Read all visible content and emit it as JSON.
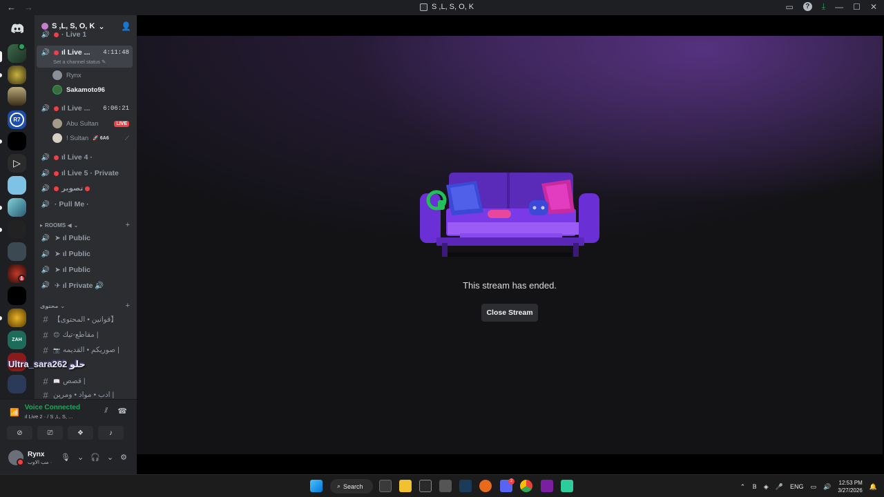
{
  "window": {
    "title": "S ,L, S, O, K",
    "back": "←",
    "forward": "→"
  },
  "server": {
    "name": "S ,L, S, O, K",
    "chevron": "⌄"
  },
  "channels": {
    "top_partial": "· Live 1",
    "live2": {
      "name": "ıl Live ...",
      "time": "4:11:48",
      "status": "Set a channel status"
    },
    "live2_users": [
      "Rynx",
      "Sakamoto96"
    ],
    "live3": {
      "name": "ıl Live ...",
      "time": "6:06:21"
    },
    "live3_users": [
      {
        "name": "Abu Sultan",
        "badge": "LIVE"
      },
      {
        "name": "! Sultan",
        "tag": "6A6"
      }
    ],
    "voice": [
      "ıl Live 4 ·",
      "ıl Live 5 · Private",
      "تصوير",
      "· Pull Me ·"
    ],
    "rooms_category": "ROOMS ◀",
    "rooms": [
      "ıl Public",
      "ıl Public",
      "ıl Public",
      "ıl Private 🔊"
    ],
    "content_category": "محتوى",
    "text": [
      "【قوانين • المحتوى】",
      "مقاطع-تيك |",
      "صوريكم • القديمه |",
      "حلو",
      "قصص |",
      "ادب • مواد • ومرين |"
    ]
  },
  "overlay": {
    "username": "Ultra_sara262",
    "word": "حلو"
  },
  "voice_connected": {
    "title": "Voice Connected",
    "sub": "ıl Live 2 · / S ,L, S, ..."
  },
  "user_panel": {
    "name": "Rynx",
    "status": "مب الاوب ·"
  },
  "stream": {
    "ended_text": "This stream has ended.",
    "close_label": "Close Stream"
  },
  "taskbar": {
    "search": "Search",
    "lang": "ENG",
    "time": "12:53 PM",
    "date": "3/27/2026",
    "discord_badge": "2"
  },
  "guild_badges": {
    "discord_home_badge": "4",
    "gag_badge": "1"
  },
  "colors": {
    "accent_green": "#23a55a",
    "live_red": "#f23f43",
    "sidebar_bg": "#2b2d31",
    "couch_purple": "#6b2fd6"
  }
}
